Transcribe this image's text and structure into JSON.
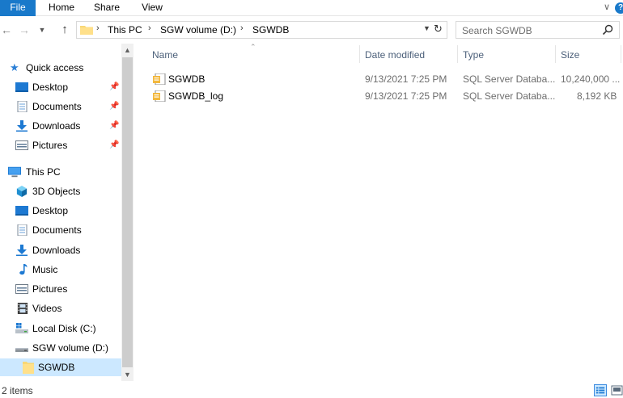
{
  "ribbon": {
    "tabs": [
      "File",
      "Home",
      "Share",
      "View"
    ],
    "help_label": "?"
  },
  "address": {
    "breadcrumbs": [
      "This PC",
      "SGW volume (D:)",
      "SGWDB"
    ]
  },
  "search": {
    "placeholder": "Search SGWDB"
  },
  "nav": {
    "quick_access": "Quick access",
    "quick_items": [
      "Desktop",
      "Documents",
      "Downloads",
      "Pictures"
    ],
    "this_pc": "This PC",
    "pc_items": [
      "3D Objects",
      "Desktop",
      "Documents",
      "Downloads",
      "Music",
      "Pictures",
      "Videos",
      "Local Disk (C:)",
      "SGW volume (D:)",
      "SGWDB"
    ]
  },
  "columns": {
    "name": "Name",
    "date": "Date modified",
    "type": "Type",
    "size": "Size"
  },
  "files": [
    {
      "name": "SGWDB",
      "date": "9/13/2021 7:25 PM",
      "type": "SQL Server Databa...",
      "size": "10,240,000 ..."
    },
    {
      "name": "SGWDB_log",
      "date": "9/13/2021 7:25 PM",
      "type": "SQL Server Databa...",
      "size": "8,192 KB"
    }
  ],
  "status": {
    "item_count": "2 items"
  },
  "colors": {
    "accent": "#1979ca",
    "selection": "#cce8ff",
    "folder": "#f8d775",
    "header_text": "#4c607a"
  }
}
